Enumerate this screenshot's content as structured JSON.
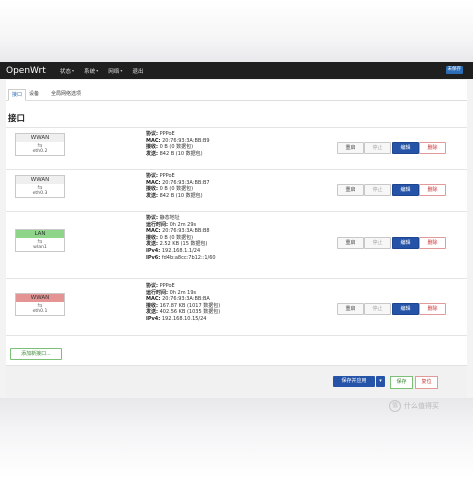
{
  "navbar": {
    "brand": "OpenWrt",
    "menu": [
      {
        "label": "状态"
      },
      {
        "label": "系统"
      },
      {
        "label": "网络"
      },
      {
        "label": "退出"
      }
    ],
    "badge": "未保存"
  },
  "tabs": [
    {
      "label": "接口"
    },
    {
      "label": "设备"
    },
    {
      "label": "全局网络选项"
    }
  ],
  "section_title": "接口",
  "interfaces": [
    {
      "name": "WWAN",
      "icon": "⇆",
      "device": "eth0.2",
      "info": [
        {
          "k": "协议:",
          "v": " PPPoE"
        },
        {
          "k": "MAC:",
          "v": " 20:76:93:3A:BB:B9"
        },
        {
          "k": "接收:",
          "v": " 0 B (0 数据包)"
        },
        {
          "k": "发送:",
          "v": " 842 B (10 数据包)"
        }
      ]
    },
    {
      "name": "WWAN",
      "icon": "⇆",
      "device": "eth0.3",
      "info": [
        {
          "k": "协议:",
          "v": " PPPoE"
        },
        {
          "k": "MAC:",
          "v": " 20:76:93:3A:BB:B7"
        },
        {
          "k": "接收:",
          "v": " 0 B (0 数据包)"
        },
        {
          "k": "发送:",
          "v": " 842 B (10 数据包)"
        }
      ]
    },
    {
      "name": "LAN",
      "icon": "⇆",
      "device": "wlan1",
      "info": [
        {
          "k": "协议:",
          "v": " 静态地址"
        },
        {
          "k": "运行时间:",
          "v": " 0h 2m 29s"
        },
        {
          "k": "MAC:",
          "v": " 20:76:93:3A:BB:B8"
        },
        {
          "k": "接收:",
          "v": " 0 B (0 数据包)"
        },
        {
          "k": "发送:",
          "v": " 2.52 KB (15 数据包)"
        },
        {
          "k": "IPv4:",
          "v": " 192.168.1.1/24"
        },
        {
          "k": "IPv6:",
          "v": " fd4b:a8cc:7b12::1/60"
        }
      ]
    },
    {
      "name": "WWAN",
      "icon": "⇆",
      "device": "eth0.1",
      "info": [
        {
          "k": "协议:",
          "v": " PPPoE"
        },
        {
          "k": "运行时间:",
          "v": " 0h 2m 19s"
        },
        {
          "k": "MAC:",
          "v": " 20:76:93:3A:BB:BA"
        },
        {
          "k": "接收:",
          "v": " 167.87 KB (1017 数据包)"
        },
        {
          "k": "发送:",
          "v": " 402.56 KB (1035 数据包)"
        },
        {
          "k": "IPv4:",
          "v": " 192.168.10.15/24"
        }
      ]
    }
  ],
  "row_buttons": {
    "restart": "重启",
    "stop": "停止",
    "edit": "编辑",
    "delete": "删除"
  },
  "add_button": "添加新接口...",
  "footer": {
    "save_apply": "保存并应用",
    "save": "保存",
    "reset": "复位"
  },
  "watermark": {
    "logo": "值",
    "text": "什么值得买"
  }
}
